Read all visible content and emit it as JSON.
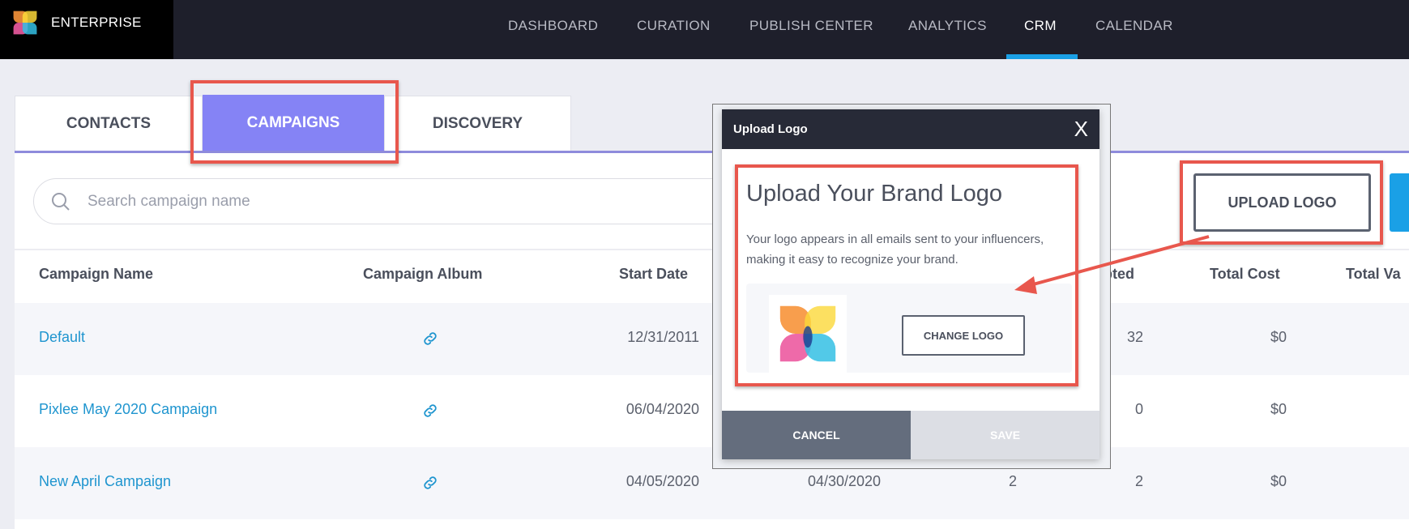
{
  "nav": {
    "brand": "ENTERPRISE",
    "items": [
      "DASHBOARD",
      "CURATION",
      "PUBLISH CENTER",
      "ANALYTICS",
      "CRM",
      "CALENDAR"
    ],
    "active": "CRM"
  },
  "tabs": [
    {
      "label": "CONTACTS"
    },
    {
      "label": "CAMPAIGNS",
      "active": true
    },
    {
      "label": "DISCOVERY"
    }
  ],
  "search": {
    "placeholder": "Search campaign name",
    "value": ""
  },
  "upload_logo_label": "UPLOAD LOGO",
  "table": {
    "headers": [
      "Campaign Name",
      "Campaign Album",
      "Start Date",
      "pted",
      "Total Cost",
      "Total Va"
    ],
    "rows": [
      {
        "name": "Default",
        "start": "12/31/2011",
        "end": "",
        "col4": "",
        "accepted": "32",
        "cost": "$0",
        "value": "$"
      },
      {
        "name": "Pixlee May 2020 Campaign",
        "start": "06/04/2020",
        "end": "",
        "col4": "",
        "accepted": "0",
        "cost": "$0",
        "value": ""
      },
      {
        "name": "New April Campaign",
        "start": "04/05/2020",
        "end": "04/30/2020",
        "col4": "2",
        "accepted": "2",
        "cost": "$0",
        "value": ""
      }
    ]
  },
  "modal": {
    "title": "Upload Logo",
    "close": "X",
    "heading": "Upload Your Brand Logo",
    "description": "Your logo appears in all emails sent to your influencers, making it easy to recognize your brand.",
    "change_logo": "CHANGE LOGO",
    "cancel": "CANCEL",
    "save": "SAVE"
  },
  "colors": {
    "accent": "#8583f5",
    "link": "#1f95cf",
    "highlight": "#e8574d",
    "nav_bg": "#1e1f2b",
    "active_underline": "#1aa0e6"
  }
}
